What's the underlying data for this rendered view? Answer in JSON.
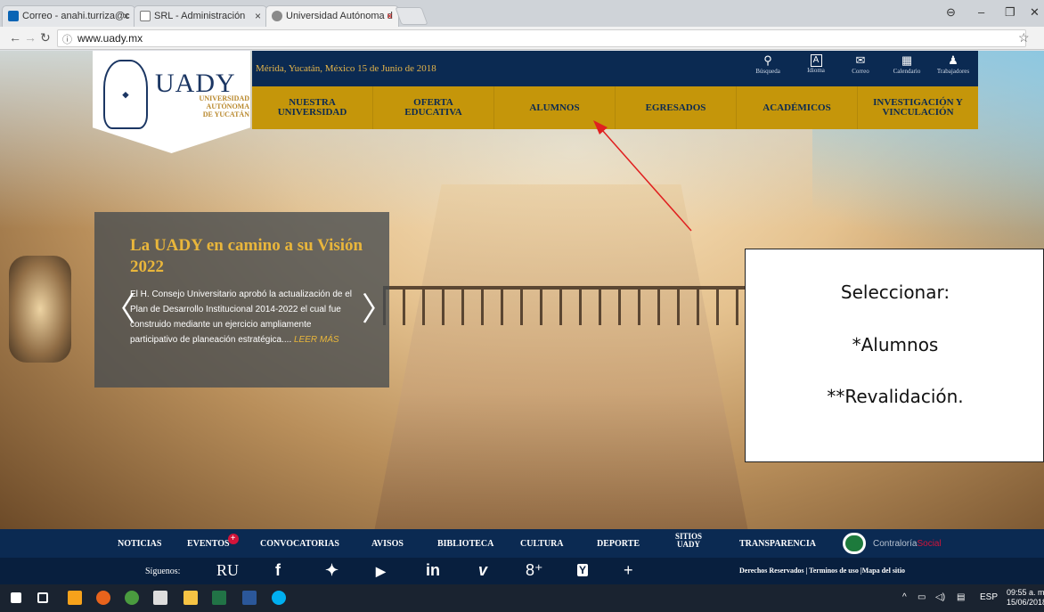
{
  "browser": {
    "tabs": [
      {
        "title": "Correo - anahi.turriza@c",
        "icon_color": "#0a64b4",
        "active": false
      },
      {
        "title": "SRL - Administración",
        "icon_color": "#ffffff",
        "active": false
      },
      {
        "title": "Universidad Autónoma d",
        "icon_color": "#8a8a8a",
        "active": true
      }
    ],
    "url": "www.uady.mx",
    "close_glyph": "×"
  },
  "site": {
    "logo_title": "UADY",
    "logo_sub": [
      "UNIVERSIDAD",
      "AUTÓNOMA",
      "DE YUCATÁN"
    ],
    "dateline": "Mérida, Yucatán, México 15 de Junio de 2018",
    "tools": [
      {
        "icon": "search-icon",
        "glyph": "🔍",
        "label": "Búsqueda"
      },
      {
        "icon": "language-icon",
        "glyph": "A",
        "label": "Idioma"
      },
      {
        "icon": "mail-icon",
        "glyph": "✉",
        "label": "Correo"
      },
      {
        "icon": "calendar-icon",
        "glyph": "▦",
        "label": "Calendario"
      },
      {
        "icon": "user-icon",
        "glyph": "👤",
        "label": "Trabajadores"
      }
    ],
    "nav": [
      {
        "line1": "NUESTRA",
        "line2": "UNIVERSIDAD"
      },
      {
        "line1": "OFERTA",
        "line2": "EDUCATIVA"
      },
      {
        "line1": "ALUMNOS",
        "line2": ""
      },
      {
        "line1": "EGRESADOS",
        "line2": ""
      },
      {
        "line1": "ACADÉMICOS",
        "line2": ""
      },
      {
        "line1": "INVESTIGACIÓN Y",
        "line2": "VINCULACIÓN"
      }
    ]
  },
  "slider": {
    "title": "La UADY en camino a su Visión 2022",
    "body": "El H. Consejo Universitario aprobó la actualización de el Plan de Desarrollo Institucional 2014-2022 el cual fue construido mediante un ejercicio ampliamente participativo de planeación estratégica.... ",
    "more": "LEER MÁS",
    "prev_glyph": "〈",
    "next_glyph": "〉"
  },
  "annotation": {
    "line1": "Seleccionar:",
    "line2": "*Alumnos",
    "line3": "**Revalidación.",
    "arrow_color": "#e02020"
  },
  "footer": {
    "links": [
      "NOTICIAS",
      "EVENTOS",
      "CONVOCATORIAS",
      "AVISOS",
      "BIBLIOTECA",
      "CULTURA",
      "DEPORTE"
    ],
    "sitios": [
      "SITIOS",
      "UADY"
    ],
    "transparencia": "TRANSPARENCIA",
    "contraloria": "Contraloría",
    "social_word": "Social",
    "events_badge": "+",
    "follow_label": "Síguenos:",
    "social": [
      "RU",
      "f",
      "🐦",
      "▶",
      "in",
      "v",
      "8⁺",
      "Y",
      "+"
    ],
    "rights": "Derechos Reservados | Terminos de uso |Mapa del sitio"
  },
  "taskbar": {
    "tray_lang": "ESP",
    "time": "09:55 a. m.",
    "date": "15/06/2018"
  }
}
